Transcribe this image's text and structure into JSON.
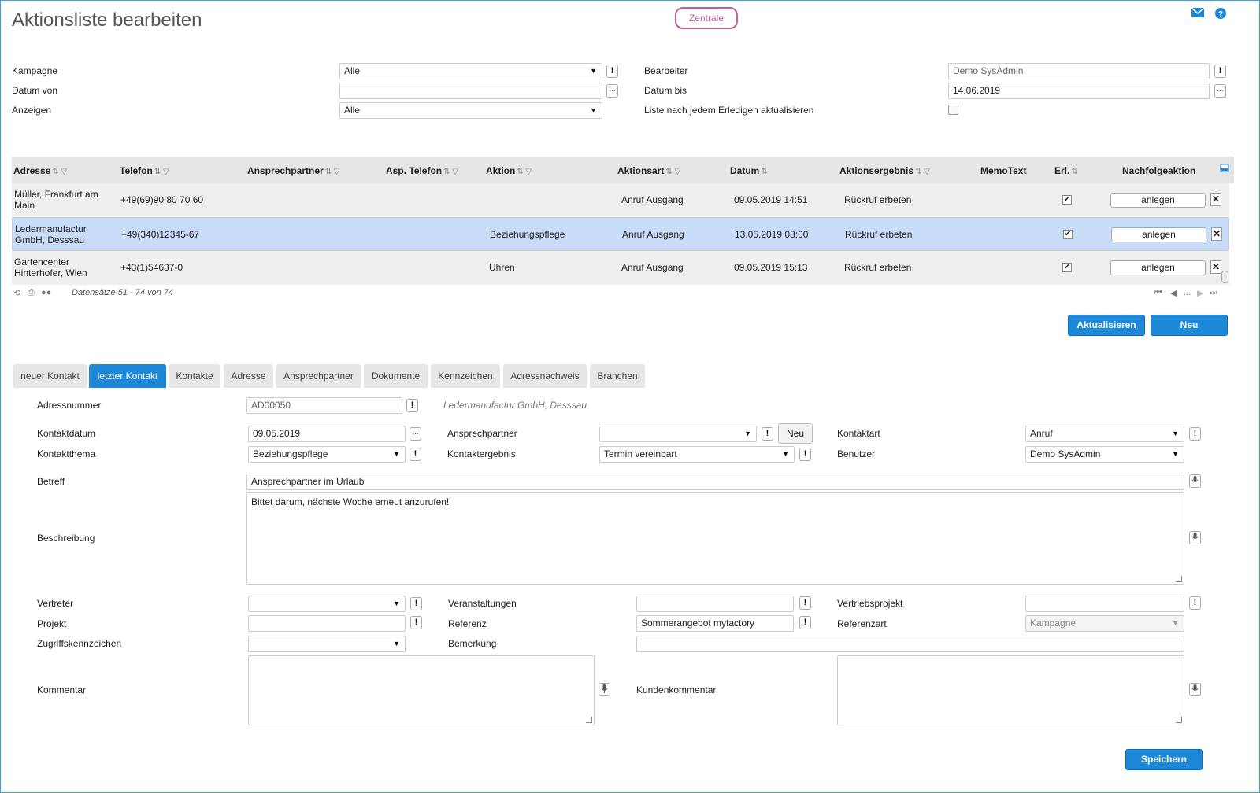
{
  "page": {
    "title": "Aktionsliste bearbeiten",
    "branch_button": "Zentrale"
  },
  "top_icons": {
    "mail": "mail-icon",
    "help": "help-icon"
  },
  "filters": {
    "kampagne_label": "Kampagne",
    "kampagne_value": "Alle",
    "datum_von_label": "Datum von",
    "datum_von_value": "",
    "anzeigen_label": "Anzeigen",
    "anzeigen_value": "Alle",
    "bearbeiter_label": "Bearbeiter",
    "bearbeiter_value": "Demo SysAdmin",
    "datum_bis_label": "Datum bis",
    "datum_bis_value": "14.06.2019",
    "refresh_label": "Liste nach jedem Erledigen aktualisieren"
  },
  "grid": {
    "columns": [
      "Adresse",
      "Telefon",
      "Ansprechpartner",
      "Asp. Telefon",
      "Aktion",
      "Aktionsart",
      "Datum",
      "Aktionsergebnis",
      "MemoText",
      "Erl.",
      "Nachfolgeaktion"
    ],
    "rows": [
      {
        "adresse_l1": "Müller, Frankfurt am",
        "adresse_l2": "Main",
        "telefon": "+49(69)90 80 70 60",
        "aktion": "",
        "aktionsart": "Anruf Ausgang",
        "datum": "09.05.2019 14:51",
        "ergebnis": "Rückruf erbeten",
        "button": "anlegen"
      },
      {
        "adresse_l1": "Ledermanufactur",
        "adresse_l2": "GmbH, Desssau",
        "telefon": "+49(340)12345-67",
        "aktion": "Beziehungspflege",
        "aktionsart": "Anruf Ausgang",
        "datum": "13.05.2019 08:00",
        "ergebnis": "Rückruf erbeten",
        "button": "anlegen"
      },
      {
        "adresse_l1": "Gartencenter",
        "adresse_l2": "Hinterhofer, Wien",
        "telefon": "+43(1)54637-0",
        "aktion": "Uhren",
        "aktionsart": "Anruf Ausgang",
        "datum": "09.05.2019 15:13",
        "ergebnis": "Rückruf erbeten",
        "button": "anlegen"
      }
    ],
    "footer": "Datensätze 51 - 74 von 74",
    "pager_ellipsis": "..."
  },
  "actions": {
    "refresh": "Aktualisieren",
    "new": "Neu"
  },
  "tabs": [
    "neuer Kontakt",
    "letzter Kontakt",
    "Kontakte",
    "Adresse",
    "Ansprechpartner",
    "Dokumente",
    "Kennzeichen",
    "Adressnachweis",
    "Branchen"
  ],
  "form": {
    "adressnummer_label": "Adressnummer",
    "adressnummer_value": "AD00050",
    "adressnummer_hint": "Ledermanufactur GmbH, Desssau",
    "kontaktdatum_label": "Kontaktdatum",
    "kontaktdatum_value": "09.05.2019",
    "ansprechpartner_label": "Ansprechpartner",
    "ansprechpartner_value": "",
    "neu_button": "Neu",
    "kontaktart_label": "Kontaktart",
    "kontaktart_value": "Anruf",
    "kontaktthema_label": "Kontaktthema",
    "kontaktthema_value": "Beziehungspflege",
    "kontaktergebnis_label": "Kontaktergebnis",
    "kontaktergebnis_value": "Termin vereinbart",
    "benutzer_label": "Benutzer",
    "benutzer_value": "Demo SysAdmin",
    "betreff_label": "Betreff",
    "betreff_value": "Ansprechpartner im Urlaub",
    "beschreibung_label": "Beschreibung",
    "beschreibung_value": "Bittet darum, nächste Woche erneut anzurufen!",
    "vertreter_label": "Vertreter",
    "veranstaltungen_label": "Veranstaltungen",
    "vertriebsprojekt_label": "Vertriebsprojekt",
    "projekt_label": "Projekt",
    "referenz_label": "Referenz",
    "referenz_value": "Sommerangebot myfactory",
    "referenzart_label": "Referenzart",
    "referenzart_value": "Kampagne",
    "zugriff_label": "Zugriffskennzeichen",
    "bemerkung_label": "Bemerkung",
    "kommentar_label": "Kommentar",
    "kundenkommentar_label": "Kundenkommentar"
  },
  "save": "Speichern"
}
